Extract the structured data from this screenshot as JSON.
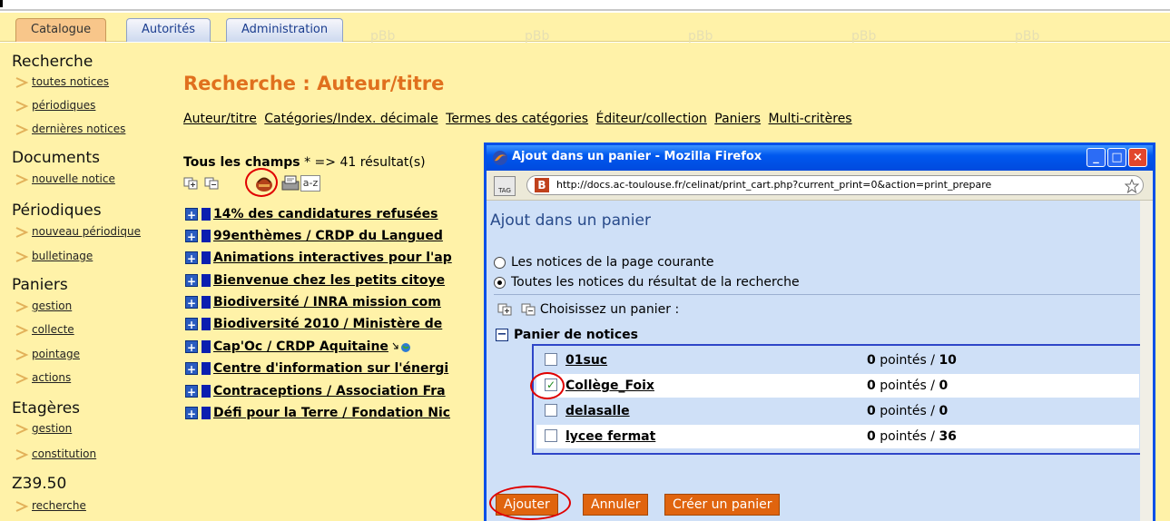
{
  "tabs": [
    {
      "label": "Catalogue"
    },
    {
      "label": "Autorités"
    },
    {
      "label": "Administration"
    }
  ],
  "watermark": "pBb",
  "sidebar": {
    "sections": [
      {
        "title": "Recherche",
        "items": [
          "toutes notices",
          "périodiques",
          "dernières notices"
        ]
      },
      {
        "title": "Documents",
        "items": [
          "nouvelle notice"
        ]
      },
      {
        "title": "Périodiques",
        "items": [
          "nouveau périodique",
          "bulletinage"
        ]
      },
      {
        "title": "Paniers",
        "items": [
          "gestion",
          "collecte",
          "pointage",
          "actions"
        ]
      },
      {
        "title": "Etagères",
        "items": [
          "gestion",
          "constitution"
        ]
      },
      {
        "title": "Z39.50",
        "items": [
          "recherche"
        ]
      }
    ]
  },
  "page": {
    "title": "Recherche : Auteur/titre",
    "subnav": [
      "Auteur/titre",
      "Catégories/Index. décimale",
      "Termes des catégories",
      "Éditeur/collection",
      "Paniers",
      "Multi-critères"
    ],
    "results_prefix": "Tous les champs",
    "results_suffix": "* => 41 résultat(s)",
    "sort_icon_label": "a-z",
    "results": [
      "14% des candidatures refusées",
      "99enthèmes / CRDP du Langued",
      "Animations interactives pour l'ap",
      "Bienvenue chez les petits citoye",
      "Biodiversité / INRA mission com",
      "Biodiversité 2010 / Ministère de",
      "Cap'Oc / CRDP Aquitaine",
      "Centre d'information sur l'énergi",
      "Contraceptions / Association Fra",
      "Défi pour la Terre / Fondation Nic"
    ]
  },
  "popup": {
    "window_title": "Ajout dans un panier - Mozilla Firefox",
    "url": "http://docs.ac-toulouse.fr/celinat/print_cart.php?current_print=0&action=print_prepare",
    "tag_label": "TAG",
    "heading": "Ajout dans un panier",
    "radio_page": "Les notices de la page courante",
    "radio_all": "Toutes les notices du résultat de la recherche",
    "choose_label": "Choisissez un panier :",
    "panier_header": "Panier de notices",
    "carts": [
      {
        "name": "01suc",
        "pointes": "0",
        "pointes_label": "pointés /",
        "total": "10",
        "checked": false
      },
      {
        "name": "Collège_Foix",
        "pointes": "0",
        "pointes_label": "pointés /",
        "total": "0",
        "checked": true
      },
      {
        "name": "delasalle",
        "pointes": "0",
        "pointes_label": "pointés /",
        "total": "0",
        "checked": false
      },
      {
        "name": "lycee fermat",
        "pointes": "0",
        "pointes_label": "pointés /",
        "total": "36",
        "checked": false
      }
    ],
    "buttons": {
      "add": "Ajouter",
      "cancel": "Annuler",
      "create": "Créer un panier"
    }
  },
  "colors": {
    "accent": "#e0701e",
    "background": "#fff2a8",
    "popup_blue": "#0058ee"
  }
}
